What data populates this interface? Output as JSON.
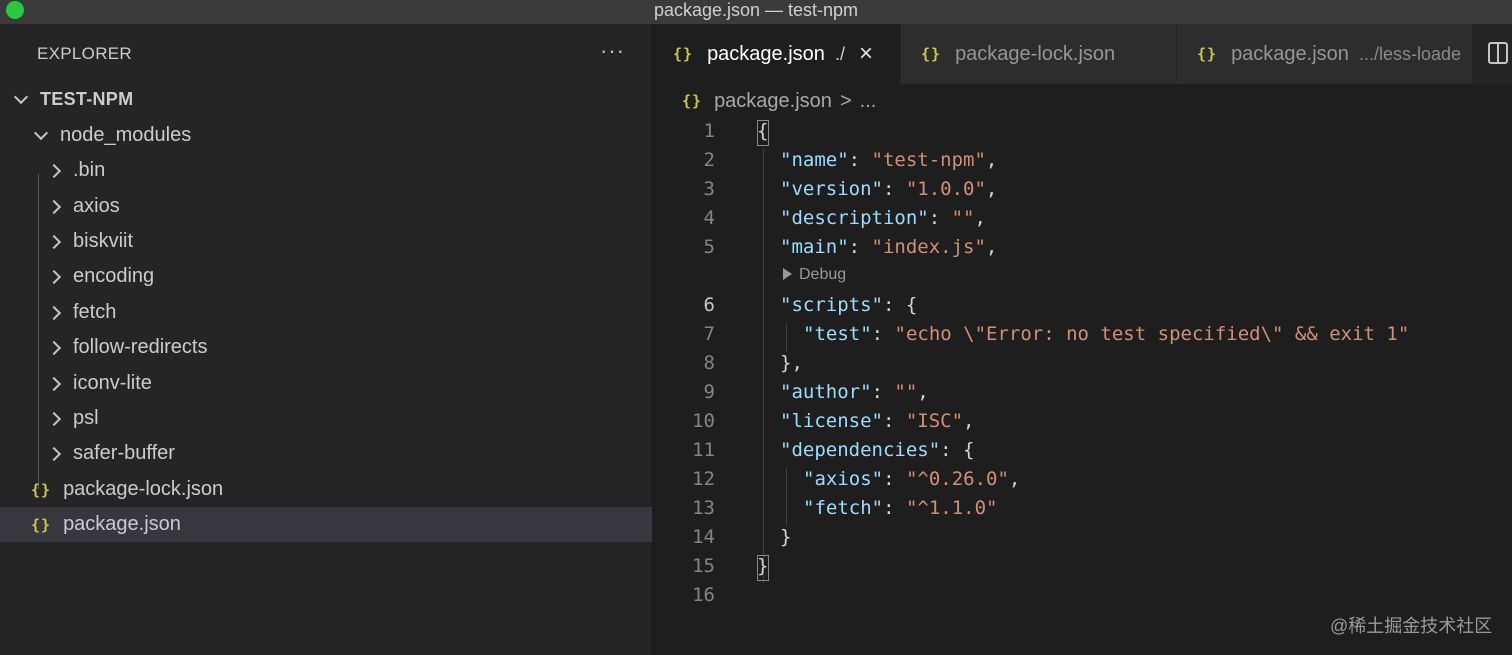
{
  "window": {
    "title": "package.json — test-npm"
  },
  "explorer": {
    "title": "EXPLORER",
    "more_icon": "···",
    "root": "TEST-NPM",
    "node_modules": "node_modules",
    "items": [
      ".bin",
      "axios",
      "biskviit",
      "encoding",
      "fetch",
      "follow-redirects",
      "iconv-lite",
      "psl",
      "safer-buffer"
    ],
    "files": [
      "package-lock.json",
      "package.json"
    ],
    "selected": "package.json"
  },
  "tabs": [
    {
      "label": "package.json",
      "desc": "./",
      "active": true
    },
    {
      "label": "package-lock.json",
      "desc": ""
    },
    {
      "label": "package.json",
      "desc": ".../less-loade"
    }
  ],
  "icons": {
    "json": "{}",
    "close": "×",
    "chevron": "chevron-icon",
    "split": "split-editor-icon"
  },
  "breadcrumb": {
    "file": "package.json",
    "sep": ">",
    "rest": "..."
  },
  "codelens": {
    "label": "Debug"
  },
  "editor": {
    "current_line": 6,
    "lines": [
      {
        "n": "1"
      },
      {
        "n": "2"
      },
      {
        "n": "3"
      },
      {
        "n": "4"
      },
      {
        "n": "5"
      },
      {
        "n": "6"
      },
      {
        "n": "7"
      },
      {
        "n": "8"
      },
      {
        "n": "9"
      },
      {
        "n": "10"
      },
      {
        "n": "11"
      },
      {
        "n": "12"
      },
      {
        "n": "13"
      },
      {
        "n": "14"
      },
      {
        "n": "15"
      },
      {
        "n": "16"
      }
    ],
    "tokens": {
      "l1": "{",
      "l2k": "\"name\"",
      "l2v": "\"test-npm\"",
      "l3k": "\"version\"",
      "l3v": "\"1.0.0\"",
      "l4k": "\"description\"",
      "l4v": "\"\"",
      "l5k": "\"main\"",
      "l5v": "\"index.js\"",
      "l6k": "\"scripts\"",
      "l6v": "{",
      "l7k": "\"test\"",
      "l7v": "\"echo \\\"Error: no test specified\\\" && exit 1\"",
      "l8": "},",
      "l9k": "\"author\"",
      "l9v": "\"\"",
      "l10k": "\"license\"",
      "l10v": "\"ISC\"",
      "l11k": "\"dependencies\"",
      "l11v": "{",
      "l12k": "\"axios\"",
      "l12v": "\"^0.26.0\"",
      "l13k": "\"fetch\"",
      "l13v": "\"^1.1.0\"",
      "l14": "}",
      "l15": "}"
    }
  },
  "watermark": "@稀土掘金技术社区",
  "colors": {
    "key": "#9cdcfe",
    "string": "#ce9178",
    "json_icon": "#cbcb41",
    "selection": "#37373d"
  }
}
